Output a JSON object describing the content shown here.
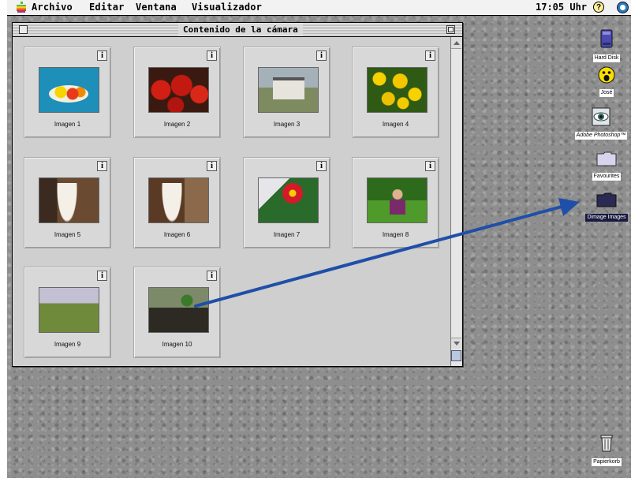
{
  "menubar": {
    "menus": [
      "Archivo",
      "Editar",
      "Ventana",
      "Visualizador"
    ],
    "clock": "17:05 Uhr",
    "help_glyph": "?"
  },
  "window": {
    "title": "Contenido de la cámara",
    "info_glyph": "i",
    "thumbnails": [
      {
        "label": "Imagen 1",
        "icon": "fruit-bowl-photo"
      },
      {
        "label": "Imagen 2",
        "icon": "strawberries-photo"
      },
      {
        "label": "Imagen 3",
        "icon": "castle-photo"
      },
      {
        "label": "Imagen 4",
        "icon": "yellow-flowers-photo"
      },
      {
        "label": "Imagen 5",
        "icon": "woman-hat-photo"
      },
      {
        "label": "Imagen 6",
        "icon": "woman-hat-photo"
      },
      {
        "label": "Imagen 7",
        "icon": "red-flower-photo"
      },
      {
        "label": "Imagen 8",
        "icon": "child-garden-photo"
      },
      {
        "label": "Imagen 9",
        "icon": "field-photo"
      },
      {
        "label": "Imagen 10",
        "icon": "plants-photo"
      }
    ]
  },
  "desktop_icons": [
    {
      "label": "Hard Disk",
      "icon": "hard-disk-icon"
    },
    {
      "label": "José",
      "icon": "smiley-icon"
    },
    {
      "label": "Adobe Photoshop™",
      "icon": "photoshop-eye-icon"
    },
    {
      "label": "Favourites",
      "icon": "folder-icon"
    },
    {
      "label": "Dimage Images",
      "icon": "folder-icon"
    },
    {
      "label": "Papierkorb",
      "icon": "trash-icon"
    }
  ],
  "colors": {
    "arrow": "#1f4fa8",
    "desktop": "#8e8e8e",
    "window_bg": "#d6d6d6"
  }
}
